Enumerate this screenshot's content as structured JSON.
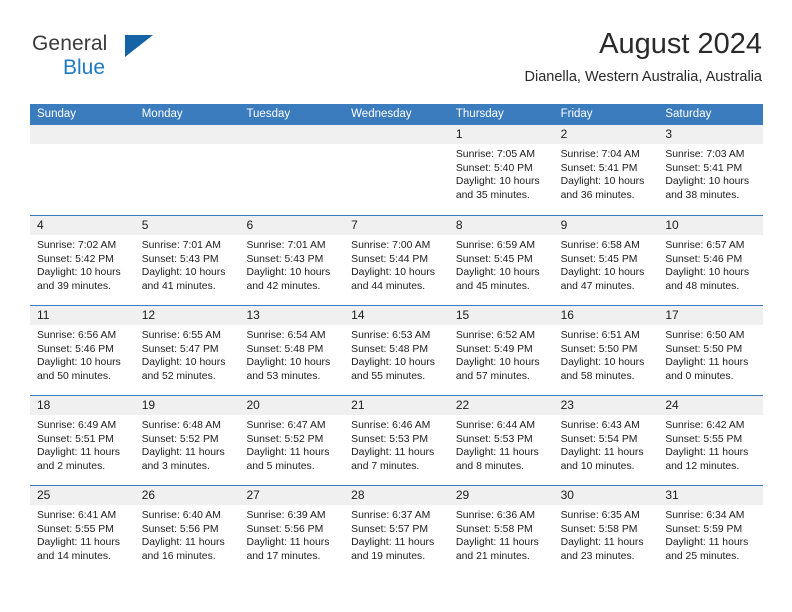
{
  "brand": {
    "name_part1": "General",
    "name_part2": "Blue",
    "triangle_color": "#1464a5",
    "blue_color": "#1f7ac4"
  },
  "header": {
    "title": "August 2024",
    "subtitle": "Dianella, Western Australia, Australia"
  },
  "theme": {
    "header_blue": "#3a7cbe",
    "day_band_gray": "#f0f0f0",
    "text_color": "#1c1c1c"
  },
  "weekdays": [
    "Sunday",
    "Monday",
    "Tuesday",
    "Wednesday",
    "Thursday",
    "Friday",
    "Saturday"
  ],
  "weeks": [
    [
      {
        "day": "",
        "lines": [
          "",
          "",
          "",
          ""
        ]
      },
      {
        "day": "",
        "lines": [
          "",
          "",
          "",
          ""
        ]
      },
      {
        "day": "",
        "lines": [
          "",
          "",
          "",
          ""
        ]
      },
      {
        "day": "",
        "lines": [
          "",
          "",
          "",
          ""
        ]
      },
      {
        "day": "1",
        "lines": [
          "Sunrise: 7:05 AM",
          "Sunset: 5:40 PM",
          "Daylight: 10 hours",
          "and 35 minutes."
        ]
      },
      {
        "day": "2",
        "lines": [
          "Sunrise: 7:04 AM",
          "Sunset: 5:41 PM",
          "Daylight: 10 hours",
          "and 36 minutes."
        ]
      },
      {
        "day": "3",
        "lines": [
          "Sunrise: 7:03 AM",
          "Sunset: 5:41 PM",
          "Daylight: 10 hours",
          "and 38 minutes."
        ]
      }
    ],
    [
      {
        "day": "4",
        "lines": [
          "Sunrise: 7:02 AM",
          "Sunset: 5:42 PM",
          "Daylight: 10 hours",
          "and 39 minutes."
        ]
      },
      {
        "day": "5",
        "lines": [
          "Sunrise: 7:01 AM",
          "Sunset: 5:43 PM",
          "Daylight: 10 hours",
          "and 41 minutes."
        ]
      },
      {
        "day": "6",
        "lines": [
          "Sunrise: 7:01 AM",
          "Sunset: 5:43 PM",
          "Daylight: 10 hours",
          "and 42 minutes."
        ]
      },
      {
        "day": "7",
        "lines": [
          "Sunrise: 7:00 AM",
          "Sunset: 5:44 PM",
          "Daylight: 10 hours",
          "and 44 minutes."
        ]
      },
      {
        "day": "8",
        "lines": [
          "Sunrise: 6:59 AM",
          "Sunset: 5:45 PM",
          "Daylight: 10 hours",
          "and 45 minutes."
        ]
      },
      {
        "day": "9",
        "lines": [
          "Sunrise: 6:58 AM",
          "Sunset: 5:45 PM",
          "Daylight: 10 hours",
          "and 47 minutes."
        ]
      },
      {
        "day": "10",
        "lines": [
          "Sunrise: 6:57 AM",
          "Sunset: 5:46 PM",
          "Daylight: 10 hours",
          "and 48 minutes."
        ]
      }
    ],
    [
      {
        "day": "11",
        "lines": [
          "Sunrise: 6:56 AM",
          "Sunset: 5:46 PM",
          "Daylight: 10 hours",
          "and 50 minutes."
        ]
      },
      {
        "day": "12",
        "lines": [
          "Sunrise: 6:55 AM",
          "Sunset: 5:47 PM",
          "Daylight: 10 hours",
          "and 52 minutes."
        ]
      },
      {
        "day": "13",
        "lines": [
          "Sunrise: 6:54 AM",
          "Sunset: 5:48 PM",
          "Daylight: 10 hours",
          "and 53 minutes."
        ]
      },
      {
        "day": "14",
        "lines": [
          "Sunrise: 6:53 AM",
          "Sunset: 5:48 PM",
          "Daylight: 10 hours",
          "and 55 minutes."
        ]
      },
      {
        "day": "15",
        "lines": [
          "Sunrise: 6:52 AM",
          "Sunset: 5:49 PM",
          "Daylight: 10 hours",
          "and 57 minutes."
        ]
      },
      {
        "day": "16",
        "lines": [
          "Sunrise: 6:51 AM",
          "Sunset: 5:50 PM",
          "Daylight: 10 hours",
          "and 58 minutes."
        ]
      },
      {
        "day": "17",
        "lines": [
          "Sunrise: 6:50 AM",
          "Sunset: 5:50 PM",
          "Daylight: 11 hours",
          "and 0 minutes."
        ]
      }
    ],
    [
      {
        "day": "18",
        "lines": [
          "Sunrise: 6:49 AM",
          "Sunset: 5:51 PM",
          "Daylight: 11 hours",
          "and 2 minutes."
        ]
      },
      {
        "day": "19",
        "lines": [
          "Sunrise: 6:48 AM",
          "Sunset: 5:52 PM",
          "Daylight: 11 hours",
          "and 3 minutes."
        ]
      },
      {
        "day": "20",
        "lines": [
          "Sunrise: 6:47 AM",
          "Sunset: 5:52 PM",
          "Daylight: 11 hours",
          "and 5 minutes."
        ]
      },
      {
        "day": "21",
        "lines": [
          "Sunrise: 6:46 AM",
          "Sunset: 5:53 PM",
          "Daylight: 11 hours",
          "and 7 minutes."
        ]
      },
      {
        "day": "22",
        "lines": [
          "Sunrise: 6:44 AM",
          "Sunset: 5:53 PM",
          "Daylight: 11 hours",
          "and 8 minutes."
        ]
      },
      {
        "day": "23",
        "lines": [
          "Sunrise: 6:43 AM",
          "Sunset: 5:54 PM",
          "Daylight: 11 hours",
          "and 10 minutes."
        ]
      },
      {
        "day": "24",
        "lines": [
          "Sunrise: 6:42 AM",
          "Sunset: 5:55 PM",
          "Daylight: 11 hours",
          "and 12 minutes."
        ]
      }
    ],
    [
      {
        "day": "25",
        "lines": [
          "Sunrise: 6:41 AM",
          "Sunset: 5:55 PM",
          "Daylight: 11 hours",
          "and 14 minutes."
        ]
      },
      {
        "day": "26",
        "lines": [
          "Sunrise: 6:40 AM",
          "Sunset: 5:56 PM",
          "Daylight: 11 hours",
          "and 16 minutes."
        ]
      },
      {
        "day": "27",
        "lines": [
          "Sunrise: 6:39 AM",
          "Sunset: 5:56 PM",
          "Daylight: 11 hours",
          "and 17 minutes."
        ]
      },
      {
        "day": "28",
        "lines": [
          "Sunrise: 6:37 AM",
          "Sunset: 5:57 PM",
          "Daylight: 11 hours",
          "and 19 minutes."
        ]
      },
      {
        "day": "29",
        "lines": [
          "Sunrise: 6:36 AM",
          "Sunset: 5:58 PM",
          "Daylight: 11 hours",
          "and 21 minutes."
        ]
      },
      {
        "day": "30",
        "lines": [
          "Sunrise: 6:35 AM",
          "Sunset: 5:58 PM",
          "Daylight: 11 hours",
          "and 23 minutes."
        ]
      },
      {
        "day": "31",
        "lines": [
          "Sunrise: 6:34 AM",
          "Sunset: 5:59 PM",
          "Daylight: 11 hours",
          "and 25 minutes."
        ]
      }
    ]
  ]
}
